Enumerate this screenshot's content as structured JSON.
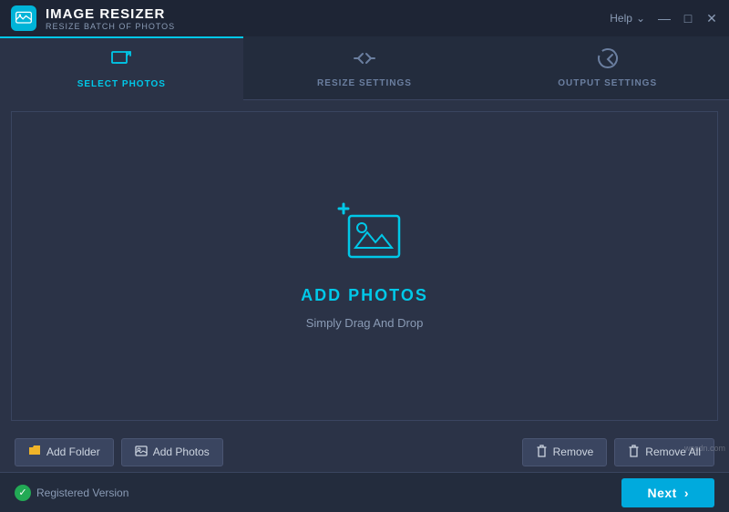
{
  "titleBar": {
    "appTitle": "IMAGE RESIZER",
    "appSubtitle": "RESIZE BATCH OF PHOTOS",
    "helpLabel": "Help",
    "minimizeBtn": "—",
    "maximizeBtn": "□",
    "closeBtn": "✕"
  },
  "tabs": [
    {
      "id": "select",
      "label": "SELECT PHOTOS",
      "active": true
    },
    {
      "id": "resize",
      "label": "RESIZE SETTINGS",
      "active": false
    },
    {
      "id": "output",
      "label": "OUTPUT SETTINGS",
      "active": false
    }
  ],
  "dropArea": {
    "addPhotosLabel": "ADD PHOTOS",
    "dragHint": "Simply Drag And Drop"
  },
  "buttons": {
    "addFolder": "Add Folder",
    "addPhotos": "Add Photos",
    "remove": "Remove",
    "removeAll": "Remove All",
    "next": "Next"
  },
  "statusBar": {
    "registeredLabel": "Registered Version"
  },
  "watermark": "wscdn.com"
}
